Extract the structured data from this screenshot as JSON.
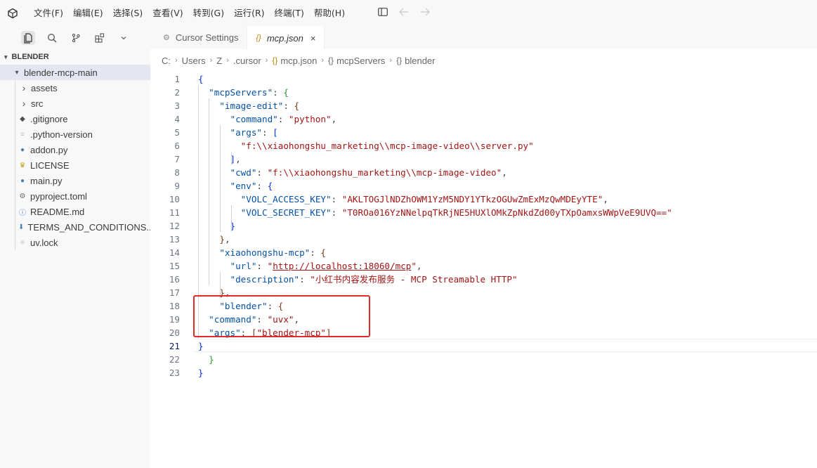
{
  "menu": [
    "文件(F)",
    "编辑(E)",
    "选择(S)",
    "查看(V)",
    "转到(G)",
    "运行(R)",
    "终端(T)",
    "帮助(H)"
  ],
  "explorer": {
    "section": "BLENDER",
    "folder": "blender-mcp-main",
    "items": [
      {
        "label": "assets",
        "kind": "folder"
      },
      {
        "label": "src",
        "kind": "folder"
      },
      {
        "label": ".gitignore",
        "kind": "git"
      },
      {
        "label": ".python-version",
        "kind": "text"
      },
      {
        "label": "addon.py",
        "kind": "python"
      },
      {
        "label": "LICENSE",
        "kind": "license"
      },
      {
        "label": "main.py",
        "kind": "python"
      },
      {
        "label": "pyproject.toml",
        "kind": "toml"
      },
      {
        "label": "README.md",
        "kind": "info"
      },
      {
        "label": "TERMS_AND_CONDITIONS....",
        "kind": "markdown"
      },
      {
        "label": "uv.lock",
        "kind": "text"
      }
    ]
  },
  "tabs": [
    {
      "label": "Cursor Settings",
      "active": false
    },
    {
      "label": "mcp.json",
      "active": true
    }
  ],
  "breadcrumbs": [
    "C:",
    "Users",
    "Z",
    ".cursor",
    "mcp.json",
    "mcpServers",
    "blender"
  ],
  "code_lines": [
    [
      [
        "{",
        "b1"
      ]
    ],
    [
      [
        "  ",
        "p"
      ],
      [
        "\"mcpServers\"",
        "k"
      ],
      [
        ": ",
        "p"
      ],
      [
        "{",
        "b2"
      ]
    ],
    [
      [
        "    ",
        "p"
      ],
      [
        "\"image-edit\"",
        "k"
      ],
      [
        ": ",
        "p"
      ],
      [
        "{",
        "b3"
      ]
    ],
    [
      [
        "      ",
        "p"
      ],
      [
        "\"command\"",
        "k"
      ],
      [
        ": ",
        "p"
      ],
      [
        "\"python\"",
        "s"
      ],
      [
        ",",
        "p"
      ]
    ],
    [
      [
        "      ",
        "p"
      ],
      [
        "\"args\"",
        "k"
      ],
      [
        ": ",
        "p"
      ],
      [
        "[",
        "b1"
      ]
    ],
    [
      [
        "        ",
        "p"
      ],
      [
        "\"f:\\\\xiaohongshu_marketing\\\\mcp-image-video\\\\server.py\"",
        "s"
      ]
    ],
    [
      [
        "      ",
        "p"
      ],
      [
        "]",
        "b1"
      ],
      [
        ",",
        "p"
      ]
    ],
    [
      [
        "      ",
        "p"
      ],
      [
        "\"cwd\"",
        "k"
      ],
      [
        ": ",
        "p"
      ],
      [
        "\"f:\\\\xiaohongshu_marketing\\\\mcp-image-video\"",
        "s"
      ],
      [
        ",",
        "p"
      ]
    ],
    [
      [
        "      ",
        "p"
      ],
      [
        "\"env\"",
        "k"
      ],
      [
        ": ",
        "p"
      ],
      [
        "{",
        "b1"
      ]
    ],
    [
      [
        "        ",
        "p"
      ],
      [
        "\"VOLC_ACCESS_KEY\"",
        "k"
      ],
      [
        ": ",
        "p"
      ],
      [
        "\"AKLTOGJlNDZhOWM1YzM5NDY1YTkzOGUwZmExMzQwMDEyYTE\"",
        "s"
      ],
      [
        ",",
        "p"
      ]
    ],
    [
      [
        "        ",
        "p"
      ],
      [
        "\"VOLC_SECRET_KEY\"",
        "k"
      ],
      [
        ": ",
        "p"
      ],
      [
        "\"T0ROa016YzNNelpqTkRjNE5HUXlOMkZpNkdZd00yTXpOamxsWWpVeE9UVQ==\"",
        "s"
      ]
    ],
    [
      [
        "      ",
        "p"
      ],
      [
        "}",
        "b1"
      ]
    ],
    [
      [
        "    ",
        "p"
      ],
      [
        "}",
        "b3"
      ],
      [
        ",",
        "p"
      ]
    ],
    [
      [
        "    ",
        "p"
      ],
      [
        "\"xiaohongshu-mcp\"",
        "k"
      ],
      [
        ": ",
        "p"
      ],
      [
        "{",
        "b3"
      ]
    ],
    [
      [
        "      ",
        "p"
      ],
      [
        "\"url\"",
        "k"
      ],
      [
        ": ",
        "p"
      ],
      [
        "\"",
        "s"
      ],
      [
        "http://localhost:18060/mcp",
        "s u"
      ],
      [
        "\"",
        "s"
      ],
      [
        ",",
        "p"
      ]
    ],
    [
      [
        "      ",
        "p"
      ],
      [
        "\"description\"",
        "k"
      ],
      [
        ": ",
        "p"
      ],
      [
        "\"小红书内容发布服务 - MCP Streamable HTTP\"",
        "s"
      ]
    ],
    [
      [
        "    ",
        "p"
      ],
      [
        "}",
        "b3"
      ],
      [
        ",",
        "p"
      ]
    ],
    [
      [
        "    ",
        "p"
      ],
      [
        "\"blender\"",
        "k"
      ],
      [
        ": ",
        "p"
      ],
      [
        "{",
        "b3"
      ]
    ],
    [
      [
        "  ",
        "p"
      ],
      [
        "\"command\"",
        "k"
      ],
      [
        ": ",
        "p"
      ],
      [
        "\"uvx\"",
        "s"
      ],
      [
        ",",
        "p"
      ]
    ],
    [
      [
        "  ",
        "p"
      ],
      [
        "\"args\"",
        "k"
      ],
      [
        ": ",
        "p"
      ],
      [
        "[",
        "b3"
      ],
      [
        "\"blender-mcp\"",
        "s"
      ],
      [
        "]",
        "b3"
      ]
    ],
    [
      [
        "}",
        "b1"
      ]
    ],
    [
      [
        "  ",
        "p"
      ],
      [
        "}",
        "b2"
      ]
    ],
    [
      [
        "}",
        "b1"
      ]
    ]
  ],
  "current_line": 21,
  "colors": {
    "key": "#0451a5",
    "string": "#a31515",
    "highlight_box": "#e02b2b",
    "selected_row": "#e4e6f1"
  }
}
